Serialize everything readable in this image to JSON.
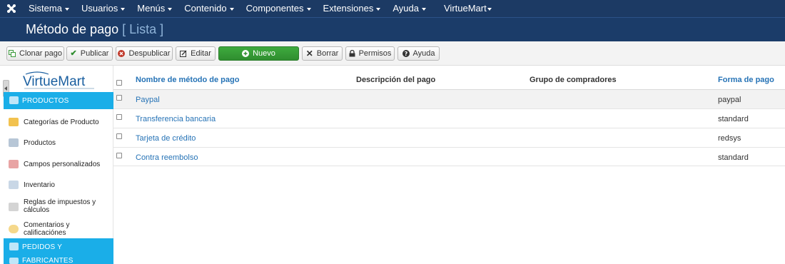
{
  "topnav": {
    "logo_icon": "joomla-logo-icon",
    "items": [
      {
        "label": "Sistema"
      },
      {
        "label": "Usuarios"
      },
      {
        "label": "Menús"
      },
      {
        "label": "Contenido"
      },
      {
        "label": "Componentes"
      },
      {
        "label": "Extensiones"
      },
      {
        "label": "Ayuda"
      },
      {
        "label": "VirtueMart"
      }
    ]
  },
  "title": {
    "main": "Método de pago",
    "sub": "[ Lista ]"
  },
  "toolbar": {
    "buttons": [
      {
        "label": "Clonar pago",
        "icon": "copy-icon"
      },
      {
        "label": "Publicar",
        "icon": "check-icon"
      },
      {
        "label": "Despublicar",
        "icon": "circle-x-icon"
      },
      {
        "label": "Editar",
        "icon": "edit-icon"
      },
      {
        "label": "Nuevo",
        "icon": "plus-circle-icon"
      },
      {
        "label": "Borrar",
        "icon": "x-icon"
      },
      {
        "label": "Permisos",
        "icon": "lock-icon"
      },
      {
        "label": "Ayuda",
        "icon": "question-icon"
      }
    ],
    "accent_color": "#2f8d2f"
  },
  "sidebar": {
    "logo_text": "VirtueMart",
    "section_color": "#1aaee8",
    "sections": [
      {
        "label": "PRODUCTOS"
      },
      {
        "label": "PEDIDOS Y"
      },
      {
        "label": "FABRICANTES"
      }
    ],
    "items": [
      {
        "label": "Categorías de Producto",
        "icon": "folder-icon"
      },
      {
        "label": "Productos",
        "icon": "products-icon"
      },
      {
        "label": "Campos personalizados",
        "icon": "custom-fields-icon"
      },
      {
        "label": "Inventario",
        "icon": "inventory-icon"
      },
      {
        "label": "Reglas de impuestos y",
        "label2": "cálculos",
        "icon": "calculator-icon"
      },
      {
        "label": "Comentarios y calificaciónes",
        "icon": "comments-icon"
      }
    ]
  },
  "table": {
    "headers": {
      "name": "Nombre de método de pago",
      "description": "Descripción del pago",
      "group": "Grupo de compradores",
      "form": "Forma de pago"
    },
    "rows": [
      {
        "name": "Paypal",
        "description": "",
        "group": "",
        "form": "paypal"
      },
      {
        "name": "Transferencia bancaria",
        "description": "",
        "group": "",
        "form": "standard"
      },
      {
        "name": "Tarjeta de crédito",
        "description": "",
        "group": "",
        "form": "redsys"
      },
      {
        "name": "Contra reembolso",
        "description": "",
        "group": "",
        "form": "standard"
      }
    ]
  }
}
